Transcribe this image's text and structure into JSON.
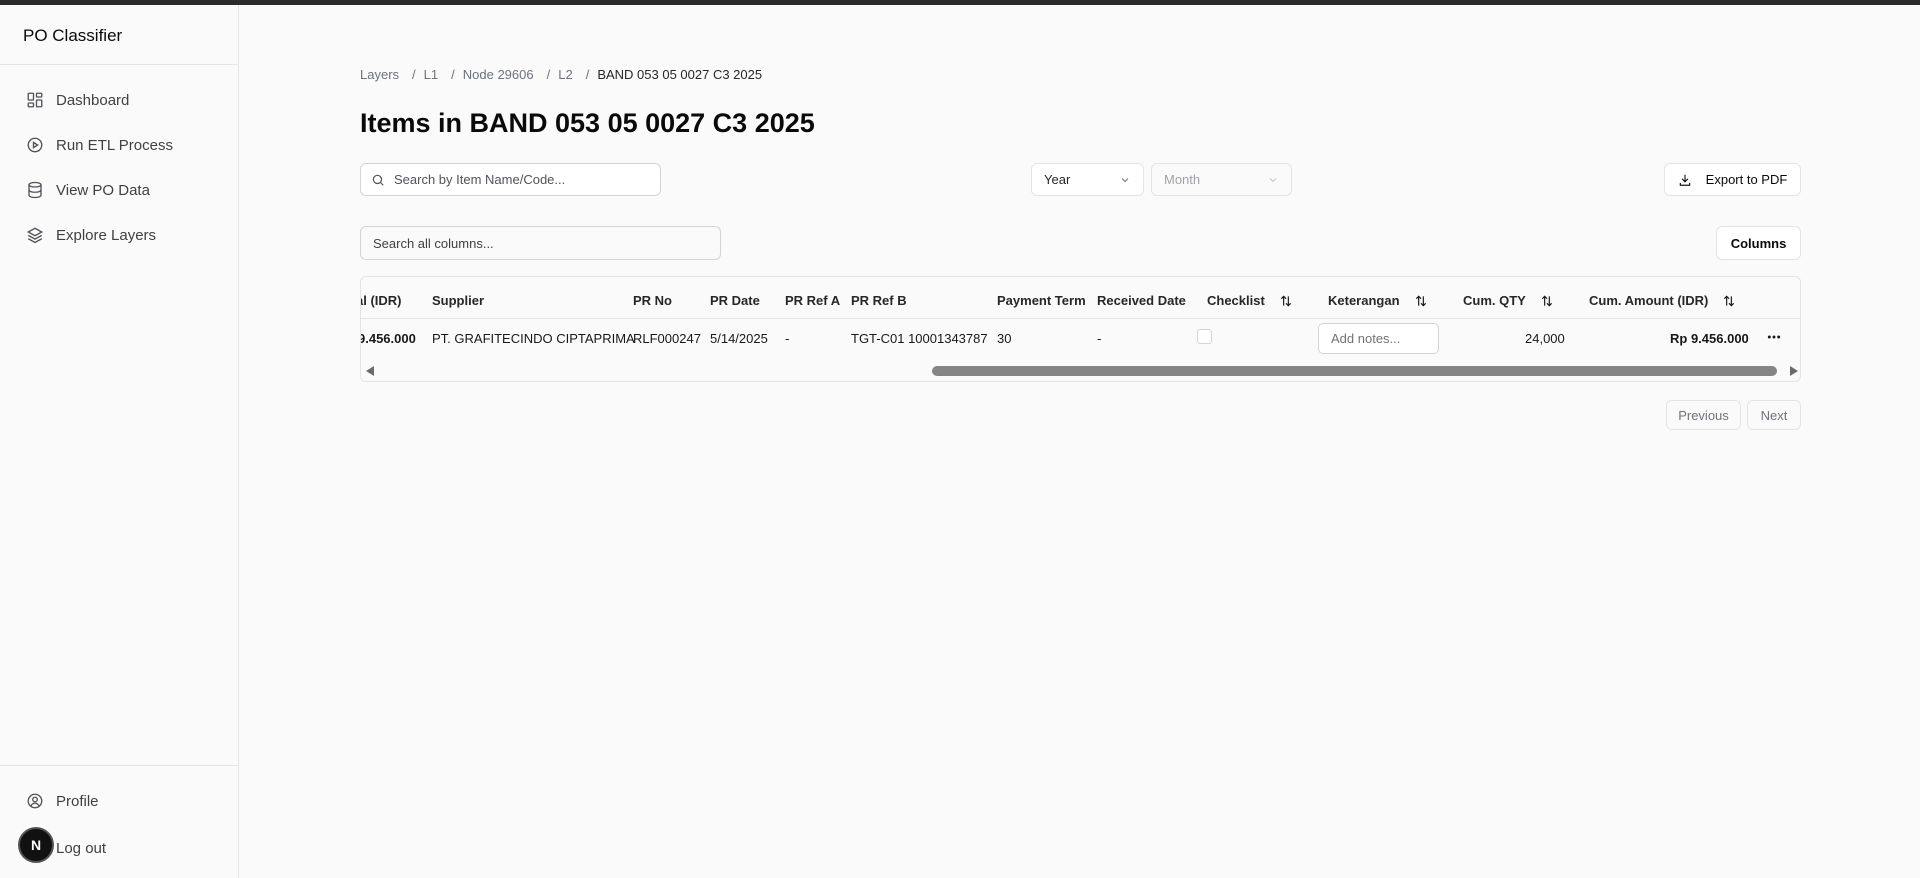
{
  "app": {
    "title": "PO Classifier"
  },
  "sidebar": {
    "items": [
      {
        "label": "Dashboard",
        "icon": "dashboard-icon"
      },
      {
        "label": "Run ETL Process",
        "icon": "play-circle-icon"
      },
      {
        "label": "View PO Data",
        "icon": "database-icon"
      },
      {
        "label": "Explore Layers",
        "icon": "layers-icon"
      }
    ],
    "bottom": [
      {
        "label": "Profile",
        "icon": "user-circle-icon"
      },
      {
        "label": "Log out",
        "icon": "logout-icon"
      }
    ],
    "badge": "N"
  },
  "breadcrumb": {
    "items": [
      "Layers",
      "L1",
      "Node 29606",
      "L2"
    ],
    "current": "BAND 053 05 0027 C3 2025",
    "separator": "/"
  },
  "page": {
    "title": "Items in BAND 053 05 0027 C3 2025"
  },
  "filters": {
    "search_placeholder": "Search by Item Name/Code...",
    "year_label": "Year",
    "month_label": "Month",
    "export_label": "Export to PDF"
  },
  "table": {
    "global_search_placeholder": "Search all columns...",
    "columns_button": "Columns",
    "headers": {
      "total": "al (IDR)",
      "supplier": "Supplier",
      "pr_no": "PR No",
      "pr_date": "PR Date",
      "pr_ref_a": "PR Ref A",
      "pr_ref_b": "PR Ref B",
      "payment_term": "Payment Term",
      "received_date": "Received Date",
      "checklist": "Checklist",
      "keterangan": "Keterangan",
      "cum_qty": "Cum. QTY",
      "cum_amount": "Cum. Amount (IDR)"
    },
    "rows": [
      {
        "total": "9.456.000",
        "supplier": "PT. GRAFITECINDO CIPTAPRIMA",
        "pr_no": "RLF000247",
        "pr_date": "5/14/2025",
        "pr_ref_a": "-",
        "pr_ref_b": "TGT-C01 10001343787",
        "payment_term": "30",
        "received_date": "-",
        "checklist": false,
        "notes_placeholder": "Add notes...",
        "cum_qty": "24,000",
        "cum_amount": "Rp 9.456.000"
      }
    ],
    "scroll_position": 0.56
  },
  "pagination": {
    "previous": "Previous",
    "next": "Next"
  },
  "colors": {
    "accent": "#0a0a0a",
    "muted": "#71717a",
    "border": "#e4e4e7",
    "background": "#fafafa"
  }
}
